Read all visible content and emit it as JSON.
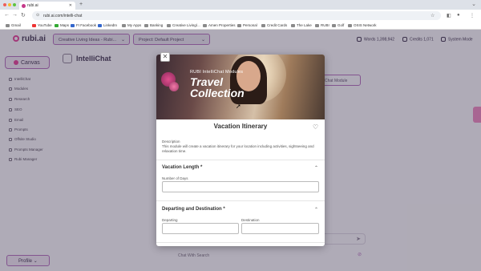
{
  "browser": {
    "tab_title": "rubi.ai",
    "url": "rubi.ai.com/intelli-chat",
    "bookmarks": [
      "Gmail",
      "YouTube",
      "Maps",
      "FI Facebook",
      "LinkedIn",
      "My Apps",
      "Banking",
      "Creative Living/...",
      "Amen Properties",
      "Personal",
      "Credit Cards",
      "The Lake",
      "RUBI",
      "Golf",
      "OSIS Network"
    ]
  },
  "app": {
    "logo": "rubi.ai",
    "collection_select": "Creative Living Ideas - Rubi...",
    "project_select": "Project: Default Project",
    "words_info": "Words 1,398,942",
    "credits_info": "Credits 1,071",
    "system_mode": "System Mode",
    "canvas_button": "Canvas",
    "sidebar": [
      "IntelliChat",
      "Modules",
      "Research",
      "SEO",
      "Email",
      "Prompts",
      "Offsite Studio",
      "Prompts Manager",
      "Rubi Manager"
    ],
    "profile_button": "Profile",
    "page_title": "IntelliChat",
    "background_button": "Chat Module",
    "chat_search_placeholder": "Chat With Search"
  },
  "modal": {
    "hero_subtitle": "RUBI IntelliChat Modules",
    "hero_title_line1": "Travel",
    "hero_title_line2": "Collection",
    "title": "Vacation Itinerary",
    "description_label": "Description",
    "description": "This module will create a vacation itinerary for your location including activities, sightseeing and relaxation time.",
    "sections": [
      {
        "title": "Vacation Length *",
        "fields": [
          {
            "label": "Number of Days"
          }
        ]
      },
      {
        "title": "Departing and Destination *",
        "fields": [
          {
            "label": "Departing"
          },
          {
            "label": "Destination"
          }
        ]
      }
    ]
  },
  "colors": {
    "brand_magenta": "#c5398a",
    "accent_purple": "#9b5ea7"
  }
}
